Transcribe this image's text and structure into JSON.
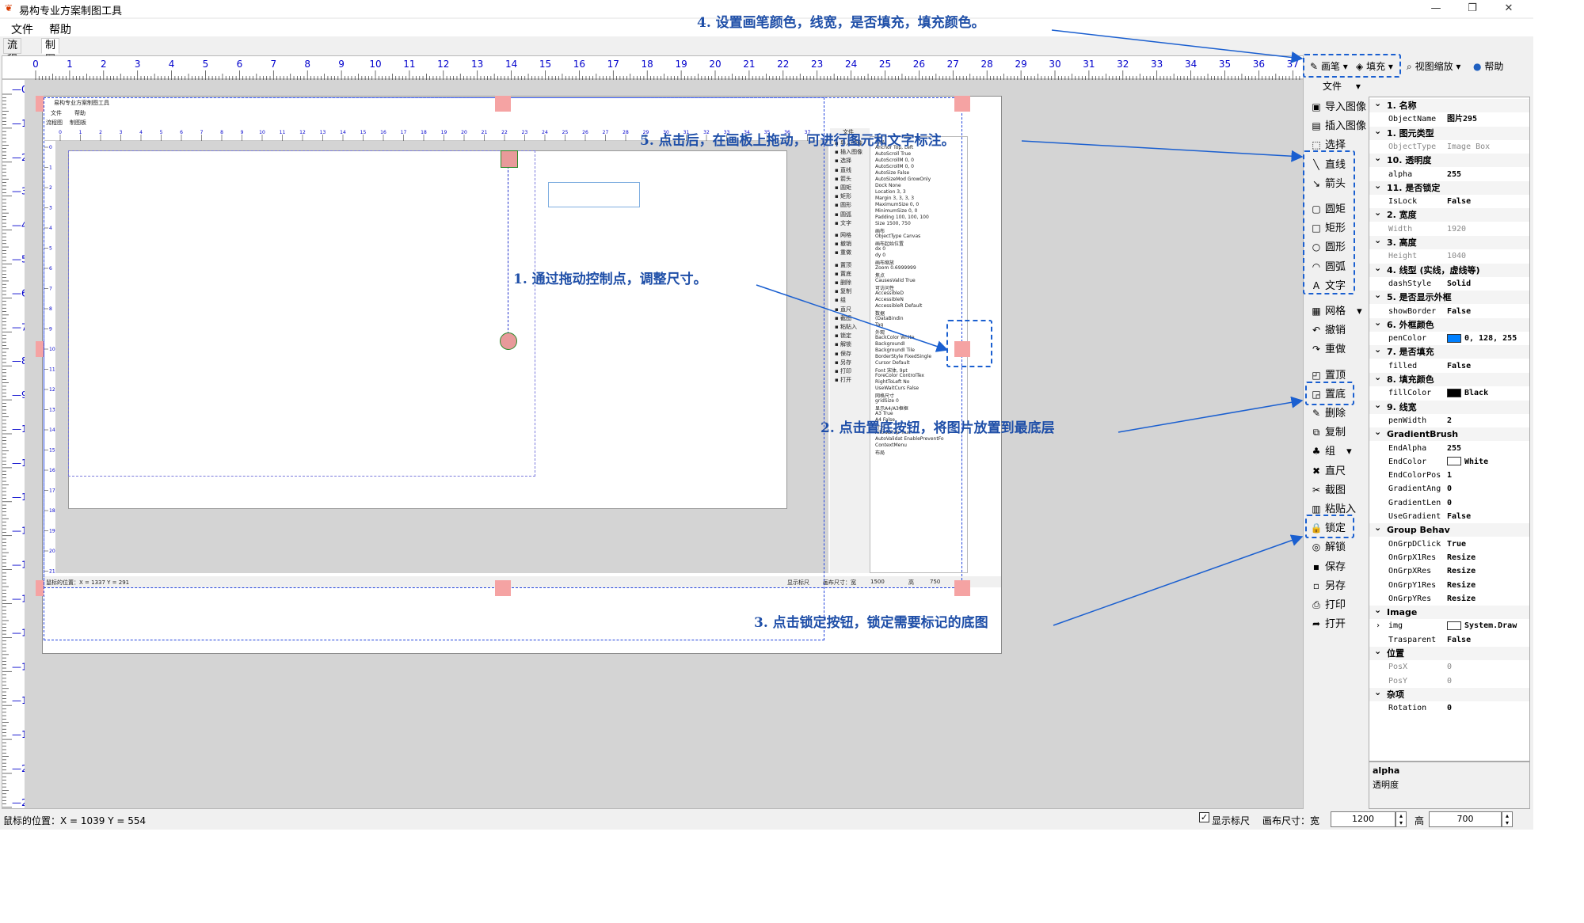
{
  "window": {
    "title": "易构专业方案制图工具",
    "minimize": "—",
    "maximize": "❐",
    "close": "✕"
  },
  "menu": [
    "文件",
    "帮助"
  ],
  "tabs": [
    "流程图",
    "制图板"
  ],
  "ruler": {
    "h": [
      "0",
      "1",
      "2",
      "3",
      "4",
      "5",
      "6",
      "7",
      "8",
      "9",
      "10",
      "11",
      "12",
      "13",
      "14",
      "15",
      "16",
      "17",
      "18",
      "19",
      "20",
      "21",
      "22",
      "23",
      "24",
      "25",
      "26",
      "27",
      "28",
      "29",
      "30",
      "31",
      "32",
      "33",
      "34",
      "35",
      "36",
      "37"
    ],
    "v": [
      "0",
      "1",
      "2",
      "3",
      "4",
      "5",
      "6",
      "7",
      "8",
      "9",
      "10",
      "11",
      "12",
      "13",
      "14",
      "15",
      "16",
      "17",
      "18",
      "19",
      "20",
      "21"
    ]
  },
  "toolbar": {
    "pen": "画笔",
    "fill": "填充",
    "zoom": "视图缩放",
    "help": "帮助",
    "file": "文件"
  },
  "tools": [
    {
      "icon": "import-image-icon",
      "glyph": "▣",
      "label": "导入图像"
    },
    {
      "icon": "insert-image-icon",
      "glyph": "▤",
      "label": "插入图像"
    },
    {
      "icon": "select-icon",
      "glyph": "⬚",
      "label": "选择"
    },
    {
      "icon": "line-icon",
      "glyph": "╲",
      "label": "直线"
    },
    {
      "icon": "arrow-icon",
      "glyph": "↘",
      "label": "箭头"
    },
    {
      "icon": "rounded-rect-icon",
      "glyph": "▢",
      "label": "圆矩"
    },
    {
      "icon": "rect-icon",
      "glyph": "□",
      "label": "矩形"
    },
    {
      "icon": "circle-icon",
      "glyph": "○",
      "label": "圆形"
    },
    {
      "icon": "arc-icon",
      "glyph": "◠",
      "label": "圆弧"
    },
    {
      "icon": "text-icon",
      "glyph": "A",
      "label": "文字"
    },
    {
      "icon": "grid-icon",
      "glyph": "▦",
      "label": "网格"
    },
    {
      "icon": "undo-icon",
      "glyph": "↶",
      "label": "撤销"
    },
    {
      "icon": "redo-icon",
      "glyph": "↷",
      "label": "重做"
    },
    {
      "icon": "bring-front-icon",
      "glyph": "◰",
      "label": "置顶"
    },
    {
      "icon": "send-back-icon",
      "glyph": "◲",
      "label": "置底"
    },
    {
      "icon": "delete-icon",
      "glyph": "✎",
      "label": "删除"
    },
    {
      "icon": "copy-icon",
      "glyph": "⧉",
      "label": "复制"
    },
    {
      "icon": "group-icon",
      "glyph": "♣",
      "label": "组"
    },
    {
      "icon": "ruler-icon",
      "glyph": "✖",
      "label": "直尺"
    },
    {
      "icon": "screenshot-icon",
      "glyph": "✂",
      "label": "截图"
    },
    {
      "icon": "paste-icon",
      "glyph": "▥",
      "label": "粘贴入"
    },
    {
      "icon": "lock-icon",
      "glyph": "🔒",
      "label": "锁定"
    },
    {
      "icon": "unlock-icon",
      "glyph": "◎",
      "label": "解锁"
    },
    {
      "icon": "save-icon",
      "glyph": "▪",
      "label": "保存"
    },
    {
      "icon": "save-as-icon",
      "glyph": "▫",
      "label": "另存"
    },
    {
      "icon": "print-icon",
      "glyph": "⎙",
      "label": "打印"
    },
    {
      "icon": "open-icon",
      "glyph": "➦",
      "label": "打开"
    }
  ],
  "properties": [
    {
      "cat": "1. 名称"
    },
    {
      "name": "ObjectName",
      "value": "图片295"
    },
    {
      "cat": "1. 图元类型"
    },
    {
      "name": "ObjectType",
      "value": "Image Box",
      "dim": true
    },
    {
      "cat": "10. 透明度"
    },
    {
      "name": "alpha",
      "value": "255"
    },
    {
      "cat": "11. 是否锁定"
    },
    {
      "name": "IsLock",
      "value": "False"
    },
    {
      "cat": "2. 宽度"
    },
    {
      "name": "Width",
      "value": "1920",
      "dim": true
    },
    {
      "cat": "3. 高度"
    },
    {
      "name": "Height",
      "value": "1040",
      "dim": true
    },
    {
      "cat": "4. 线型 (实线，虚线等)"
    },
    {
      "name": "dashStyle",
      "value": "Solid"
    },
    {
      "cat": "5. 是否显示外框"
    },
    {
      "name": "showBorder",
      "value": "False"
    },
    {
      "cat": "6. 外框颜色"
    },
    {
      "name": "penColor",
      "value": "0, 128, 255",
      "swatch": "#0080ff"
    },
    {
      "cat": "7. 是否填充"
    },
    {
      "name": "filled",
      "value": "False"
    },
    {
      "cat": "8. 填充颜色"
    },
    {
      "name": "fillColor",
      "value": "Black",
      "swatch": "#000000"
    },
    {
      "cat": "9. 线宽"
    },
    {
      "name": "penWidth",
      "value": "2"
    },
    {
      "cat": "GradientBrush"
    },
    {
      "name": "EndAlpha",
      "value": "255"
    },
    {
      "name": "EndColor",
      "value": "White",
      "swatch": "#ffffff"
    },
    {
      "name": "EndColorPos",
      "value": "1"
    },
    {
      "name": "GradientAng",
      "value": "0"
    },
    {
      "name": "GradientLen",
      "value": "0"
    },
    {
      "name": "UseGradient",
      "value": "False"
    },
    {
      "cat": "Group Behav"
    },
    {
      "name": "OnGrpDClick",
      "value": "True"
    },
    {
      "name": "OnGrpX1Res",
      "value": "Resize"
    },
    {
      "name": "OnGrpXRes",
      "value": "Resize"
    },
    {
      "name": "OnGrpY1Res",
      "value": "Resize"
    },
    {
      "name": "OnGrpYRes",
      "value": "Resize"
    },
    {
      "cat": "Image"
    },
    {
      "name": "img",
      "value": "System.Draw",
      "swatch": "#ffffff",
      "expand": true
    },
    {
      "name": "Trasparent",
      "value": "False"
    },
    {
      "cat": "位置"
    },
    {
      "name": "PosX",
      "value": "0",
      "dim": true
    },
    {
      "name": "PosY",
      "value": "0",
      "dim": true
    },
    {
      "cat": "杂项"
    },
    {
      "name": "Rotation",
      "value": "0"
    }
  ],
  "description": {
    "title": "alpha",
    "text": "透明度"
  },
  "status": {
    "mouse": "鼠标的位置：X = 1039 Y = 554",
    "show_ruler": "显示标尺",
    "canvas_size": "画布尺寸：宽",
    "width": "1200",
    "height_label": "高",
    "height": "700"
  },
  "annotations": {
    "a1": "1. 通过拖动控制点，调整尺寸。",
    "a2": "2. 点击置底按钮，将图片放置到最底层",
    "a3": "3. 点击锁定按钮，锁定需要标记的底图",
    "a4": "4. 设置画笔颜色，线宽，是否填充，填充颜色。",
    "a5": "5. 点击后，在画板上拖动，可进行图元和文字标注。"
  },
  "mini": {
    "title": "易构专业方案制图工具",
    "menu1": "文件",
    "menu2": "帮助",
    "tab1": "流程图",
    "tab2": "制图板",
    "file": "文件",
    "status": "鼠标的位置：X = 1337 Y = 291",
    "show_ruler": "显示标尺",
    "canvas_w_label": "画布尺寸：宽",
    "canvas_w": "1500",
    "canvas_h_label": "高",
    "canvas_h": "750",
    "tools": [
      "导入图像",
      "插入图像",
      "选择",
      "直线",
      "箭头",
      "圆矩",
      "矩形",
      "圆形",
      "圆弧",
      "文字",
      "网格",
      "撤销",
      "重做",
      "置顶",
      "置底",
      "删除",
      "复制",
      "组",
      "直尺",
      "截图",
      "粘贴入",
      "锁定",
      "解锁",
      "保存",
      "另存",
      "打印",
      "打开"
    ],
    "props": [
      "布局",
      "Anchor  Top, Left",
      "AutoScroll  True",
      "AutoScrollM  0, 0",
      "AutoScrollM  0, 0",
      "AutoSize  False",
      "AutoSizeMod  GrowOnly",
      "Dock  None",
      "Location  3, 3",
      "Margin  3, 3, 3, 3",
      "MaximumSize  0, 0",
      "MinimumSize  0, 0",
      "Padding  100, 100, 100",
      "Size  1500, 750",
      "画布",
      "ObjectType  Canvas",
      "画布起始位置",
      "dx  0",
      "dy  0",
      "画布缩放",
      "Zoom  0.6999999",
      "焦点",
      "CausesValid  True",
      "可访问性",
      "AccessibleD",
      "AccessibleN",
      "AccessibleR  Default",
      "数据",
      "(DataBindin",
      "Tag",
      "外观",
      "BackColor  White",
      "BackgroundI",
      "BackgroundI  Tile",
      "BorderStyle  FixedSingle",
      "Cursor  Default",
      "Font  宋体, 9pt",
      "ForeColor  ControlTex",
      "RightToLeft  No",
      "UseWaitCurs  False",
      "网格尺寸",
      "gridSize  0",
      "显示A4/A3框框",
      "A3  True",
      "A4  False",
      "行为",
      "AllowDrop  True",
      "AutoValidat  EnablePreventFo",
      "ContextMenu",
      "布局"
    ]
  },
  "colors": {
    "accent": "#1a5fd0",
    "ruler_text": "#0000cc",
    "handle": "#f5a3a3",
    "annotation": "#1f4fa8"
  }
}
